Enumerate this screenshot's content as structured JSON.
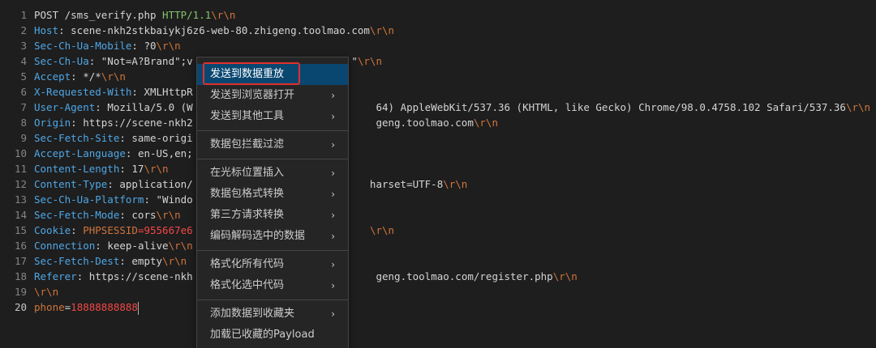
{
  "editor": {
    "lines": [
      {
        "n": "1",
        "segs": [
          {
            "t": "POST /sms_verify.php ",
            "c": "v"
          },
          {
            "t": "HTTP/1.1",
            "c": "ver"
          },
          {
            "t": "\\r\\n",
            "c": "esc"
          }
        ]
      },
      {
        "n": "2",
        "segs": [
          {
            "t": "Host",
            "c": "k"
          },
          {
            "t": ": scene-nkh2stkbaiykj6z6-web-80.zhigeng.toolmao.com",
            "c": "v"
          },
          {
            "t": "\\r\\n",
            "c": "esc"
          }
        ]
      },
      {
        "n": "3",
        "segs": [
          {
            "t": "Sec-Ch-Ua-Mobile",
            "c": "k"
          },
          {
            "t": ": ?0",
            "c": "v"
          },
          {
            "t": "\\r\\n",
            "c": "esc"
          }
        ]
      },
      {
        "n": "4",
        "segs": [
          {
            "t": "Sec-Ch-Ua",
            "c": "k"
          },
          {
            "t": ": \"Not=A?Brand\";v",
            "c": "v"
          },
          {
            "t": "                          ",
            "c": "v"
          },
          {
            "t": "\"",
            "c": "v"
          },
          {
            "t": "\\r\\n",
            "c": "esc"
          }
        ]
      },
      {
        "n": "5",
        "segs": [
          {
            "t": "Accept",
            "c": "k"
          },
          {
            "t": ": */*",
            "c": "v"
          },
          {
            "t": "\\r\\n",
            "c": "esc"
          }
        ]
      },
      {
        "n": "6",
        "segs": [
          {
            "t": "X-Requested-With",
            "c": "k"
          },
          {
            "t": ": XMLHttpR",
            "c": "v"
          }
        ]
      },
      {
        "n": "7",
        "segs": [
          {
            "t": "User-Agent",
            "c": "k"
          },
          {
            "t": ": Mozilla/5.0 (W",
            "c": "v"
          },
          {
            "t": "                              ",
            "c": "v"
          },
          {
            "t": "64) AppleWebKit/537.36 (KHTML, like Gecko) Chrome/98.0.4758.102 Safari/537.36",
            "c": "v"
          },
          {
            "t": "\\r\\n",
            "c": "esc"
          }
        ]
      },
      {
        "n": "8",
        "segs": [
          {
            "t": "Origin",
            "c": "k"
          },
          {
            "t": ": https://scene-nkh2",
            "c": "v"
          },
          {
            "t": "                              ",
            "c": "v"
          },
          {
            "t": "geng.toolmao.com",
            "c": "v"
          },
          {
            "t": "\\r\\n",
            "c": "esc"
          }
        ]
      },
      {
        "n": "9",
        "segs": [
          {
            "t": "Sec-Fetch-Site",
            "c": "k"
          },
          {
            "t": ": same-origi",
            "c": "v"
          }
        ]
      },
      {
        "n": "10",
        "segs": [
          {
            "t": "Accept-Language",
            "c": "k"
          },
          {
            "t": ": en-US,en;",
            "c": "v"
          }
        ]
      },
      {
        "n": "11",
        "segs": [
          {
            "t": "Content-Length",
            "c": "k"
          },
          {
            "t": ": 17",
            "c": "v"
          },
          {
            "t": "\\r\\n",
            "c": "esc"
          }
        ]
      },
      {
        "n": "12",
        "segs": [
          {
            "t": "Content-Type",
            "c": "k"
          },
          {
            "t": ": application/",
            "c": "v"
          },
          {
            "t": "                             ",
            "c": "v"
          },
          {
            "t": "harset=UTF-8",
            "c": "v"
          },
          {
            "t": "\\r\\n",
            "c": "esc"
          }
        ]
      },
      {
        "n": "13",
        "segs": [
          {
            "t": "Sec-Ch-Ua-Platform",
            "c": "k"
          },
          {
            "t": ": \"Windo",
            "c": "v"
          }
        ]
      },
      {
        "n": "14",
        "segs": [
          {
            "t": "Sec-Fetch-Mode",
            "c": "k"
          },
          {
            "t": ": cors",
            "c": "v"
          },
          {
            "t": "\\r\\n",
            "c": "esc"
          }
        ]
      },
      {
        "n": "15",
        "segs": [
          {
            "t": "Cookie",
            "c": "k"
          },
          {
            "t": ": ",
            "c": "v"
          },
          {
            "t": "PHPSESSID",
            "c": "esc"
          },
          {
            "t": "=955667e6",
            "c": "red"
          },
          {
            "t": "                             ",
            "c": "v"
          },
          {
            "t": "\\r\\n",
            "c": "esc"
          }
        ]
      },
      {
        "n": "16",
        "segs": [
          {
            "t": "Connection",
            "c": "k"
          },
          {
            "t": ": keep-alive",
            "c": "v"
          },
          {
            "t": "\\r\\n",
            "c": "esc"
          }
        ]
      },
      {
        "n": "17",
        "segs": [
          {
            "t": "Sec-Fetch-Dest",
            "c": "k"
          },
          {
            "t": ": empty",
            "c": "v"
          },
          {
            "t": "\\r\\n",
            "c": "esc"
          }
        ]
      },
      {
        "n": "18",
        "segs": [
          {
            "t": "Referer",
            "c": "k"
          },
          {
            "t": ": https://scene-nkh",
            "c": "v"
          },
          {
            "t": "                              ",
            "c": "v"
          },
          {
            "t": "geng.toolmao.com/register.php",
            "c": "v"
          },
          {
            "t": "\\r\\n",
            "c": "esc"
          }
        ]
      },
      {
        "n": "19",
        "segs": [
          {
            "t": "\\r\\n",
            "c": "esc"
          }
        ]
      },
      {
        "n": "20",
        "segs": [
          {
            "t": "phone",
            "c": "esc"
          },
          {
            "t": "=",
            "c": "v"
          },
          {
            "t": "18888888888",
            "c": "red"
          }
        ],
        "active": true
      }
    ]
  },
  "context_menu": {
    "groups": [
      [
        {
          "label": "发送到数据重放",
          "submenu": false,
          "highlighted": true
        },
        {
          "label": "发送到浏览器打开",
          "submenu": true
        },
        {
          "label": "发送到其他工具",
          "submenu": true
        }
      ],
      [
        {
          "label": "数据包拦截过滤",
          "submenu": true
        }
      ],
      [
        {
          "label": "在光标位置插入",
          "submenu": true
        },
        {
          "label": "数据包格式转换",
          "submenu": true
        },
        {
          "label": "第三方请求转换",
          "submenu": true
        },
        {
          "label": "编码解码选中的数据",
          "submenu": true
        }
      ],
      [
        {
          "label": "格式化所有代码",
          "submenu": true
        },
        {
          "label": "格式化选中代码",
          "submenu": true
        }
      ],
      [
        {
          "label": "添加数据到收藏夹",
          "submenu": true
        },
        {
          "label": "加载已收藏的Payload",
          "submenu": false
        }
      ]
    ],
    "arrow_glyph": "›"
  },
  "colors": {
    "background": "#1e1e1e",
    "key": "#4fa7e6",
    "escape": "#d0753c",
    "value_red": "#f44747",
    "http_version": "#85c46c",
    "menu_highlight": "#094771",
    "annotation_box": "#e0302b"
  }
}
